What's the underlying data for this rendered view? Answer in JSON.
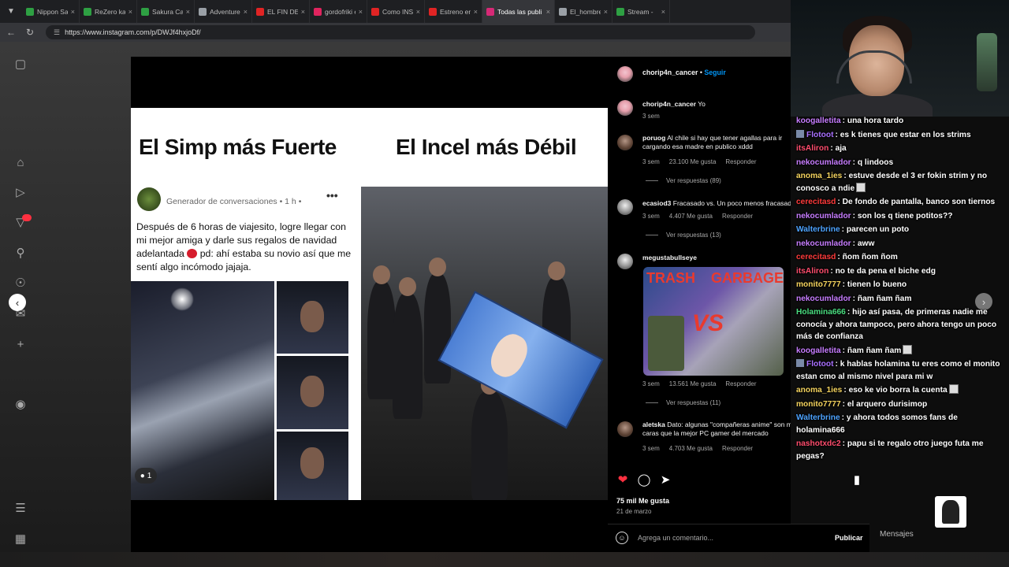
{
  "browser": {
    "tabs": [
      {
        "label": "Nippon Sango",
        "color": "#2ea043"
      },
      {
        "label": "ReZero kara H",
        "color": "#2ea043"
      },
      {
        "label": "Sakura Card C",
        "color": "#2ea043"
      },
      {
        "label": "Adventure Tim",
        "color": "#9aa0a6"
      },
      {
        "label": "EL FIN DEL PA",
        "color": "#e02424"
      },
      {
        "label": "gordofriki ede",
        "color": "#e0245e"
      },
      {
        "label": "Como INSTALA",
        "color": "#e02424"
      },
      {
        "label": "Estreno en Cin",
        "color": "#e02424"
      },
      {
        "label": "Todas las publi",
        "color": "#d62976",
        "active": true
      },
      {
        "label": "El_hombre_pol",
        "color": "#9aa0a6"
      },
      {
        "label": "Stream -",
        "color": "#2ea043"
      }
    ],
    "url": "https://www.instagram.com/p/DWJf4hxjoDf/"
  },
  "post": {
    "meme_left_title": "El Simp más Fuerte",
    "meme_right_title": "El Incel más Débil",
    "fb_meta": "Generador de conversaciones • 1 h •",
    "fb_text": "Después de 6 horas de viajesito, logre llegar con mi mejor amiga y darle sus regalos de navidad adelantada",
    "fb_text_tail": "pd: ahí estaba su novio así que me sentí algo incómodo jajaja.",
    "people_count": "1"
  },
  "comments": {
    "header_user": "chorip4n_cancer",
    "follow_label": "Seguir",
    "items": [
      {
        "user": "chorip4n_cancer",
        "text": "Yo",
        "time": "3 sem"
      },
      {
        "user": "poruog",
        "text": "Al chile si hay que tener agallas para ir cargando esa madre en publico xddd",
        "time": "3 sem",
        "likes": "23.100 Me gusta",
        "reply": "Responder",
        "view_replies": "Ver respuestas (89)"
      },
      {
        "user": "ecasiod3",
        "text": "Fracasado vs. Un poco menos fracasado",
        "time": "3 sem",
        "likes": "4.407 Me gusta",
        "reply": "Responder",
        "view_replies": "Ver respuestas (13)"
      },
      {
        "user": "megustabullseye",
        "text": "",
        "time": "3 sem",
        "likes": "13.561 Me gusta",
        "reply": "Responder",
        "view_replies": "Ver respuestas (11)",
        "image_text_1": "TRASH",
        "image_text_2": "GARBAGE",
        "image_text_3": "VS"
      },
      {
        "user": "aletska",
        "text": "Dato: algunas \"compañeras anime\" son mas caras que la mejor PC gamer del mercado",
        "time": "3 sem",
        "likes": "4.703 Me gusta",
        "reply": "Responder"
      }
    ],
    "likes_total": "75 mil Me gusta",
    "date": "21 de marzo",
    "add_comment_placeholder": "Agrega un comentario...",
    "publish_label": "Publicar"
  },
  "chat": {
    "messages": [
      {
        "user": "koogalletita",
        "color": "#c77dff",
        "text": "una hora tardo"
      },
      {
        "user": "Flotoot",
        "color": "#a970ff",
        "text": "es k tienes que estar en los strims",
        "badge": true
      },
      {
        "user": "itsAliron",
        "color": "#ff4d6d",
        "text": "aja"
      },
      {
        "user": "nekocumlador",
        "color": "#c77dff",
        "text": "q lindoos"
      },
      {
        "user": "anoma_1ies",
        "color": "#f4d35e",
        "text": "estuve desde el 3 er fokin strim y no conosco a ndie",
        "emote": true
      },
      {
        "user": "cerecitasd",
        "color": "#ff3b3b",
        "text": "De fondo de pantalla, banco son tiernos"
      },
      {
        "user": "nekocumlador",
        "color": "#c77dff",
        "text": "son los q tiene potitos??"
      },
      {
        "user": "Walterbrine",
        "color": "#4da3ff",
        "text": "parecen un poto"
      },
      {
        "user": "nekocumlador",
        "color": "#c77dff",
        "text": "aww"
      },
      {
        "user": "cerecitasd",
        "color": "#ff3b3b",
        "text": "ñom ñom ñom"
      },
      {
        "user": "itsAliron",
        "color": "#ff4d6d",
        "text": "no te da pena el biche edg"
      },
      {
        "user": "monito7777",
        "color": "#f4d35e",
        "text": "tienen lo bueno"
      },
      {
        "user": "nekocumlador",
        "color": "#c77dff",
        "text": "ñam ñam ñam"
      },
      {
        "user": "Holamina666",
        "color": "#4ade80",
        "text": "hijo así pasa, de primeras nadie me conocía y ahora tampoco, pero ahora tengo un poco más de confianza"
      },
      {
        "user": "koogalletita",
        "color": "#c77dff",
        "text": "ñam ñam ñam",
        "emote": true
      },
      {
        "user": "Flotoot",
        "color": "#a970ff",
        "text": "k hablas holamina tu eres como el monito estan cmo al mismo nivel para mi w",
        "badge": true
      },
      {
        "user": "anoma_1ies",
        "color": "#f4d35e",
        "text": "eso ke vio borra la cuenta",
        "emote": true
      },
      {
        "user": "monito7777",
        "color": "#f4d35e",
        "text": "el arquero durisimop"
      },
      {
        "user": "Walterbrine",
        "color": "#4da3ff",
        "text": "y ahora todos somos fans de holamina666"
      },
      {
        "user": "nashotxdc2",
        "color": "#ff4d6d",
        "text": "papu si te regalo otro juego futa me pegas?"
      }
    ],
    "messages_label": "Mensajes"
  }
}
